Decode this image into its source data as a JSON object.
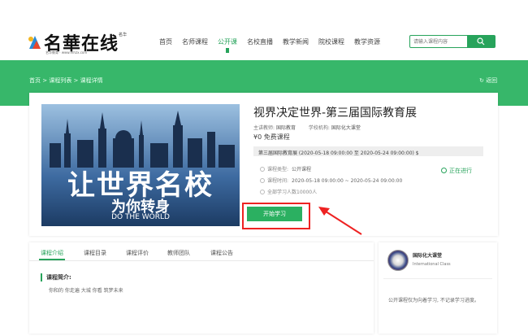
{
  "header": {
    "brand": "名華在线",
    "brand_sub": "名华教育 · www.mhzx.com",
    "brand_side": "名华",
    "nav": [
      {
        "label": "首页"
      },
      {
        "label": "名师课程"
      },
      {
        "label": "公开课"
      },
      {
        "label": "名校直播"
      },
      {
        "label": "教学新闻"
      },
      {
        "label": "院校课程"
      },
      {
        "label": "教学资源"
      }
    ],
    "active_nav": "公开课",
    "search_placeholder": "请输入课程内容"
  },
  "breadcrumb": {
    "text": "首页 > 课程列表 > 课程详情",
    "back_label": "返回"
  },
  "course": {
    "cover_line1": "让世界名校",
    "cover_line2": "为你转身",
    "cover_line3": "DO THE WORLD",
    "title": "视界决定世界-第三届国际教育展",
    "teacher_label": "主讲教师:",
    "teacher": "国际教育",
    "school_label": "学校机构:",
    "school": "国际化大课堂",
    "price": "¥0 免费课程",
    "schedule": "第三届国际教育展 (2020-05-18 09:00:00 至 2020-05-24 09:00:00) $",
    "type_label": "课程类型:",
    "type_value": "公开课程",
    "time_label": "课程时间:",
    "time_value": "2020-05-18 09:00:00 ~ 2020-05-24 09:00:00",
    "learners": "全部学习人数10000人",
    "status": "正在进行",
    "start_button": "开始学习"
  },
  "tabs": {
    "items": [
      "课程介绍",
      "课程目录",
      "课程评价",
      "教师团队",
      "课程公告"
    ],
    "active": "课程介绍"
  },
  "intro": {
    "heading": "课程简介:",
    "text": "你和的 你走遍 大城 你看 筑梦未来"
  },
  "side": {
    "name": "国际化大课堂",
    "sub": "International Class",
    "note": "公开课程仅为向着学习, 不记录学习进度。"
  },
  "colors": {
    "accent": "#27a35b",
    "band": "#37b76a",
    "highlight": "#e22222"
  }
}
